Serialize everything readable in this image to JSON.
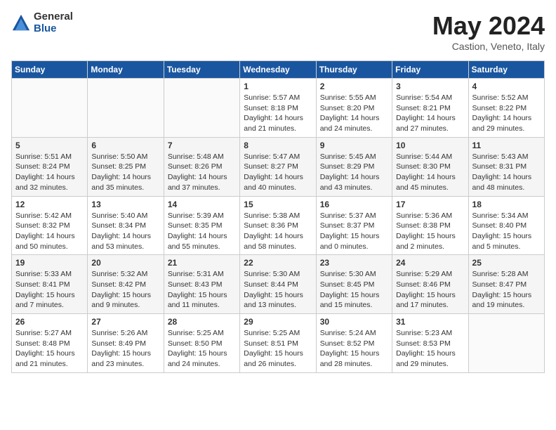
{
  "logo": {
    "general": "General",
    "blue": "Blue"
  },
  "title": {
    "month_year": "May 2024",
    "location": "Castion, Veneto, Italy"
  },
  "weekdays": [
    "Sunday",
    "Monday",
    "Tuesday",
    "Wednesday",
    "Thursday",
    "Friday",
    "Saturday"
  ],
  "weeks": [
    [
      {
        "day": "",
        "info": ""
      },
      {
        "day": "",
        "info": ""
      },
      {
        "day": "",
        "info": ""
      },
      {
        "day": "1",
        "info": "Sunrise: 5:57 AM\nSunset: 8:18 PM\nDaylight: 14 hours\nand 21 minutes."
      },
      {
        "day": "2",
        "info": "Sunrise: 5:55 AM\nSunset: 8:20 PM\nDaylight: 14 hours\nand 24 minutes."
      },
      {
        "day": "3",
        "info": "Sunrise: 5:54 AM\nSunset: 8:21 PM\nDaylight: 14 hours\nand 27 minutes."
      },
      {
        "day": "4",
        "info": "Sunrise: 5:52 AM\nSunset: 8:22 PM\nDaylight: 14 hours\nand 29 minutes."
      }
    ],
    [
      {
        "day": "5",
        "info": "Sunrise: 5:51 AM\nSunset: 8:24 PM\nDaylight: 14 hours\nand 32 minutes."
      },
      {
        "day": "6",
        "info": "Sunrise: 5:50 AM\nSunset: 8:25 PM\nDaylight: 14 hours\nand 35 minutes."
      },
      {
        "day": "7",
        "info": "Sunrise: 5:48 AM\nSunset: 8:26 PM\nDaylight: 14 hours\nand 37 minutes."
      },
      {
        "day": "8",
        "info": "Sunrise: 5:47 AM\nSunset: 8:27 PM\nDaylight: 14 hours\nand 40 minutes."
      },
      {
        "day": "9",
        "info": "Sunrise: 5:45 AM\nSunset: 8:29 PM\nDaylight: 14 hours\nand 43 minutes."
      },
      {
        "day": "10",
        "info": "Sunrise: 5:44 AM\nSunset: 8:30 PM\nDaylight: 14 hours\nand 45 minutes."
      },
      {
        "day": "11",
        "info": "Sunrise: 5:43 AM\nSunset: 8:31 PM\nDaylight: 14 hours\nand 48 minutes."
      }
    ],
    [
      {
        "day": "12",
        "info": "Sunrise: 5:42 AM\nSunset: 8:32 PM\nDaylight: 14 hours\nand 50 minutes."
      },
      {
        "day": "13",
        "info": "Sunrise: 5:40 AM\nSunset: 8:34 PM\nDaylight: 14 hours\nand 53 minutes."
      },
      {
        "day": "14",
        "info": "Sunrise: 5:39 AM\nSunset: 8:35 PM\nDaylight: 14 hours\nand 55 minutes."
      },
      {
        "day": "15",
        "info": "Sunrise: 5:38 AM\nSunset: 8:36 PM\nDaylight: 14 hours\nand 58 minutes."
      },
      {
        "day": "16",
        "info": "Sunrise: 5:37 AM\nSunset: 8:37 PM\nDaylight: 15 hours\nand 0 minutes."
      },
      {
        "day": "17",
        "info": "Sunrise: 5:36 AM\nSunset: 8:38 PM\nDaylight: 15 hours\nand 2 minutes."
      },
      {
        "day": "18",
        "info": "Sunrise: 5:34 AM\nSunset: 8:40 PM\nDaylight: 15 hours\nand 5 minutes."
      }
    ],
    [
      {
        "day": "19",
        "info": "Sunrise: 5:33 AM\nSunset: 8:41 PM\nDaylight: 15 hours\nand 7 minutes."
      },
      {
        "day": "20",
        "info": "Sunrise: 5:32 AM\nSunset: 8:42 PM\nDaylight: 15 hours\nand 9 minutes."
      },
      {
        "day": "21",
        "info": "Sunrise: 5:31 AM\nSunset: 8:43 PM\nDaylight: 15 hours\nand 11 minutes."
      },
      {
        "day": "22",
        "info": "Sunrise: 5:30 AM\nSunset: 8:44 PM\nDaylight: 15 hours\nand 13 minutes."
      },
      {
        "day": "23",
        "info": "Sunrise: 5:30 AM\nSunset: 8:45 PM\nDaylight: 15 hours\nand 15 minutes."
      },
      {
        "day": "24",
        "info": "Sunrise: 5:29 AM\nSunset: 8:46 PM\nDaylight: 15 hours\nand 17 minutes."
      },
      {
        "day": "25",
        "info": "Sunrise: 5:28 AM\nSunset: 8:47 PM\nDaylight: 15 hours\nand 19 minutes."
      }
    ],
    [
      {
        "day": "26",
        "info": "Sunrise: 5:27 AM\nSunset: 8:48 PM\nDaylight: 15 hours\nand 21 minutes."
      },
      {
        "day": "27",
        "info": "Sunrise: 5:26 AM\nSunset: 8:49 PM\nDaylight: 15 hours\nand 23 minutes."
      },
      {
        "day": "28",
        "info": "Sunrise: 5:25 AM\nSunset: 8:50 PM\nDaylight: 15 hours\nand 24 minutes."
      },
      {
        "day": "29",
        "info": "Sunrise: 5:25 AM\nSunset: 8:51 PM\nDaylight: 15 hours\nand 26 minutes."
      },
      {
        "day": "30",
        "info": "Sunrise: 5:24 AM\nSunset: 8:52 PM\nDaylight: 15 hours\nand 28 minutes."
      },
      {
        "day": "31",
        "info": "Sunrise: 5:23 AM\nSunset: 8:53 PM\nDaylight: 15 hours\nand 29 minutes."
      },
      {
        "day": "",
        "info": ""
      }
    ]
  ]
}
